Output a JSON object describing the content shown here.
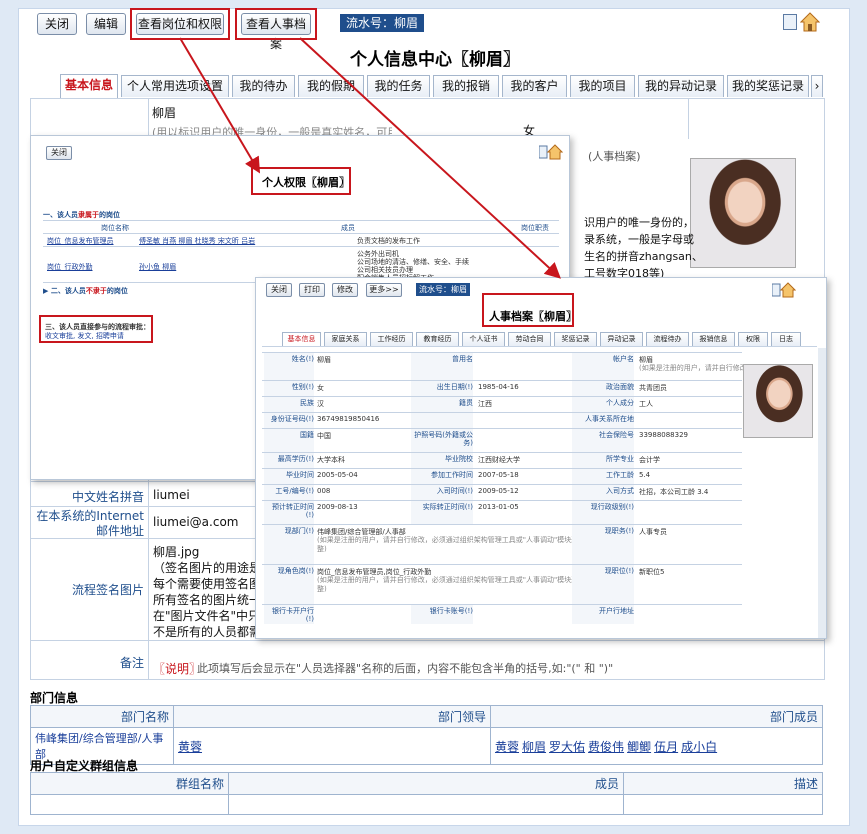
{
  "toolbar": {
    "close": "关闭",
    "edit": "编辑",
    "view_roles": "查看岗位和权限",
    "view_hr": "查看人事档案",
    "serial": "流水号：柳眉"
  },
  "main": {
    "title": "个人信息中心〖柳眉〗",
    "tabs": [
      "基本信息",
      "个人常用选项设置",
      "我的待办",
      "我的假期",
      "我的任务",
      "我的报销",
      "我的客户",
      "我的项目",
      "我的异动记录",
      "我的奖惩记录"
    ],
    "tab_more": "›",
    "name_value": "柳眉",
    "name_hint": "(用以标识用户的唯一身份，一般是真实姓名，可用",
    "gender_value": "女",
    "hr_hint": "(人事档案)",
    "side_text1": "识用户的唯一身份的，",
    "side_text2": "录系统，一般是字母或",
    "side_text3": "生名的拼音zhangsan、",
    "side_text4": "工号数字018等)",
    "pinyin_label": "中文姓名拼音",
    "pinyin_value": "liumei",
    "email_label": "在本系统的Internet邮件地址",
    "email_value": "liumei@a.com",
    "sign_label": "流程签名图片",
    "sign_file": "柳眉.jpg",
    "sign_hint1": "（签名图片的用途是",
    "sign_hint2": "每个需要使用签名图",
    "sign_hint3": "所有签名的图片统一",
    "sign_hint4": "在\"图片文件名\"中只",
    "sign_hint5": "不是所有的人员都需",
    "remark_label": "备注",
    "remark_note_tag": "〖说明〗",
    "remark_note": "此项填写后会显示在\"人员选择器\"名称的后面，内容不能包含半角的括号,如:\"(\" 和 \")\""
  },
  "dept": {
    "section": "部门信息",
    "headers": [
      "部门名称",
      "部门领导",
      "部门成员"
    ],
    "name": "伟峰集团/综合管理部/人事部",
    "leader": "黄蓉",
    "members": [
      "黄蓉",
      "柳眉",
      "罗大佑",
      "费俊伟",
      "鲫鲫",
      "伍月",
      "成小白"
    ]
  },
  "group": {
    "section": "用户自定义群组信息",
    "headers": [
      "群组名称",
      "成员",
      "描述"
    ]
  },
  "perm": {
    "close": "关闭",
    "title": "个人权限〖柳眉〗",
    "s1_prefix": "一、该人员",
    "s1_red": "隶属于",
    "s1_suffix": "的岗位",
    "col_role": "岗位名称",
    "col_member": "成员",
    "col_duty": "岗位职责",
    "r1_role": "岗位_信息发布管理员",
    "r1_members": "傅圣敏 肖燕 柳眉 杜晓秀 宋文昕 吕岩",
    "r1_duty": "负责文档的发布工作",
    "r2_role": "岗位_行政外勤",
    "r2_members": "孙小鱼 柳眉",
    "r2_duty1": "公务外出司机",
    "r2_duty2": "公司场地的清洁、修缮、安全、手续",
    "r2_duty3": "公司相关技员办理",
    "r2_duty4": "配合销售人员招标解工作",
    "s2_prefix": "二、该人员",
    "s2_red": "不隶于",
    "s2_suffix": "的岗位",
    "s3": "三、该人员直接参与的流程审批：",
    "s3_links": "收文审批, 发文, 招聘申请"
  },
  "hr": {
    "close": "关闭",
    "print": "打印",
    "modify": "修改",
    "more": "更多>>",
    "serial": "流水号：柳眉",
    "title": "人事档案〖柳眉〗",
    "tabs": [
      "基本信息",
      "家庭关系",
      "工作经历",
      "教育经历",
      "个人证书",
      "劳动合同",
      "奖惩记录",
      "异动记录",
      "流程待办",
      "报销信息",
      "权限",
      "日志"
    ],
    "f": {
      "name_l": "姓名(!)",
      "name_v": "柳眉",
      "used_l": "曾用名",
      "account_l": "帐户名",
      "account_v": "柳眉",
      "account_hint": "(如果是注册的用户，请并自行修改)",
      "sex_l": "性别(!)",
      "sex_v": "女",
      "birth_l": "出生日期(!)",
      "birth_v": "1985-04-16",
      "party_l": "政治面貌",
      "party_v": "共青团员",
      "nation_l": "民族",
      "nation_v": "汉",
      "native_l": "籍贯",
      "native_v": "江西",
      "class_l": "个人成分",
      "class_v": "工人",
      "id_l": "身份证号码(!)",
      "id_v": "36749819850416",
      "rel_l": "人事关系所在地",
      "country_l": "国籍",
      "country_v": "中国",
      "passport_l": "护照号码(外籍或公务)",
      "social_l": "社会保险号",
      "social_v": "33988088329",
      "edu_l": "最高学历(!)",
      "edu_v": "大学本科",
      "school_l": "毕业院校",
      "school_v": "江西财经大学",
      "major_l": "所学专业",
      "major_v": "会计学",
      "grad_l": "毕业时间",
      "grad_v": "2005-05-04",
      "work_l": "参加工作时间",
      "work_v": "2007-05-18",
      "years_l": "工作工龄",
      "years_v": "5.4",
      "no_l": "工号/编号(!)",
      "no_v": "008",
      "join_l": "入司时间(!)",
      "join_v": "2009-05-12",
      "way_l": "入司方式",
      "way_v": "社招，本公司工龄 3.4",
      "trial_l": "预计转正时间(!)",
      "trial_v": "2009-08-13",
      "reg_l": "实际转正时间(!)",
      "reg_v": "2013-01-05",
      "now_l": "现行政级别(!)",
      "dept_l": "现部门(!)",
      "dept_v": "伟峰集团/综合管理部/人事部",
      "dept_hint": "(如果是注册的用户，请并自行修改，必须通过组织架构管理工具或\"人事调动\"模块进行调整)",
      "job_l": "现职务(!)",
      "job_v": "人事专员",
      "role_l": "现角色岗(!)",
      "role_v": "岗位_信息发布管理员,岗位_行政外勤",
      "role_hint": "(如果是注册的用户，请并自行修改，必须通过组织架构管理工具或\"人事调动\"模块进行调整)",
      "rank_l": "现职位(!)",
      "rank_v": "新职位5",
      "bank_l": "银行卡开户行(!)",
      "card_l": "银行卡账号(!)",
      "addr_l": "开户行地址"
    }
  }
}
